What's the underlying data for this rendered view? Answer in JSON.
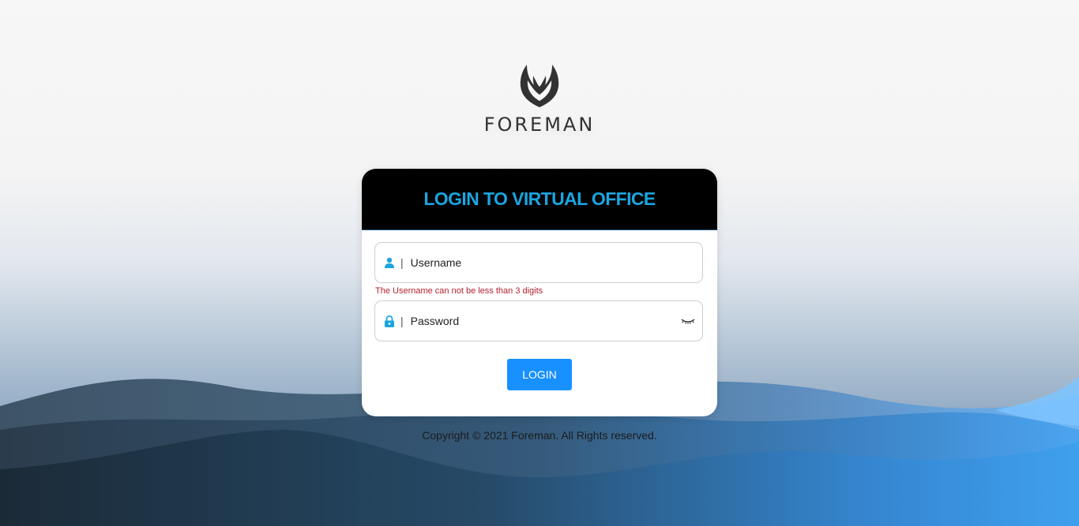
{
  "brand": {
    "name": "FOREMAN"
  },
  "card": {
    "title": "LOGIN TO VIRTUAL OFFICE"
  },
  "form": {
    "username": {
      "placeholder": "Username",
      "value": "",
      "error": "The Username can not be less than 3 digits"
    },
    "password": {
      "placeholder": "Password",
      "value": ""
    },
    "separator": "|",
    "login_label": "LOGIN"
  },
  "footer": {
    "copyright": "Copyright © 2021 Foreman. All Rights reserved."
  },
  "colors": {
    "accent": "#1ba5e0",
    "button": "#1890ff",
    "error": "#b3222c",
    "header_bg": "#000000"
  },
  "icons": {
    "user": "user-icon",
    "lock": "lock-icon",
    "eye": "eye-closed-icon",
    "logo": "foreman-wings-logo"
  }
}
